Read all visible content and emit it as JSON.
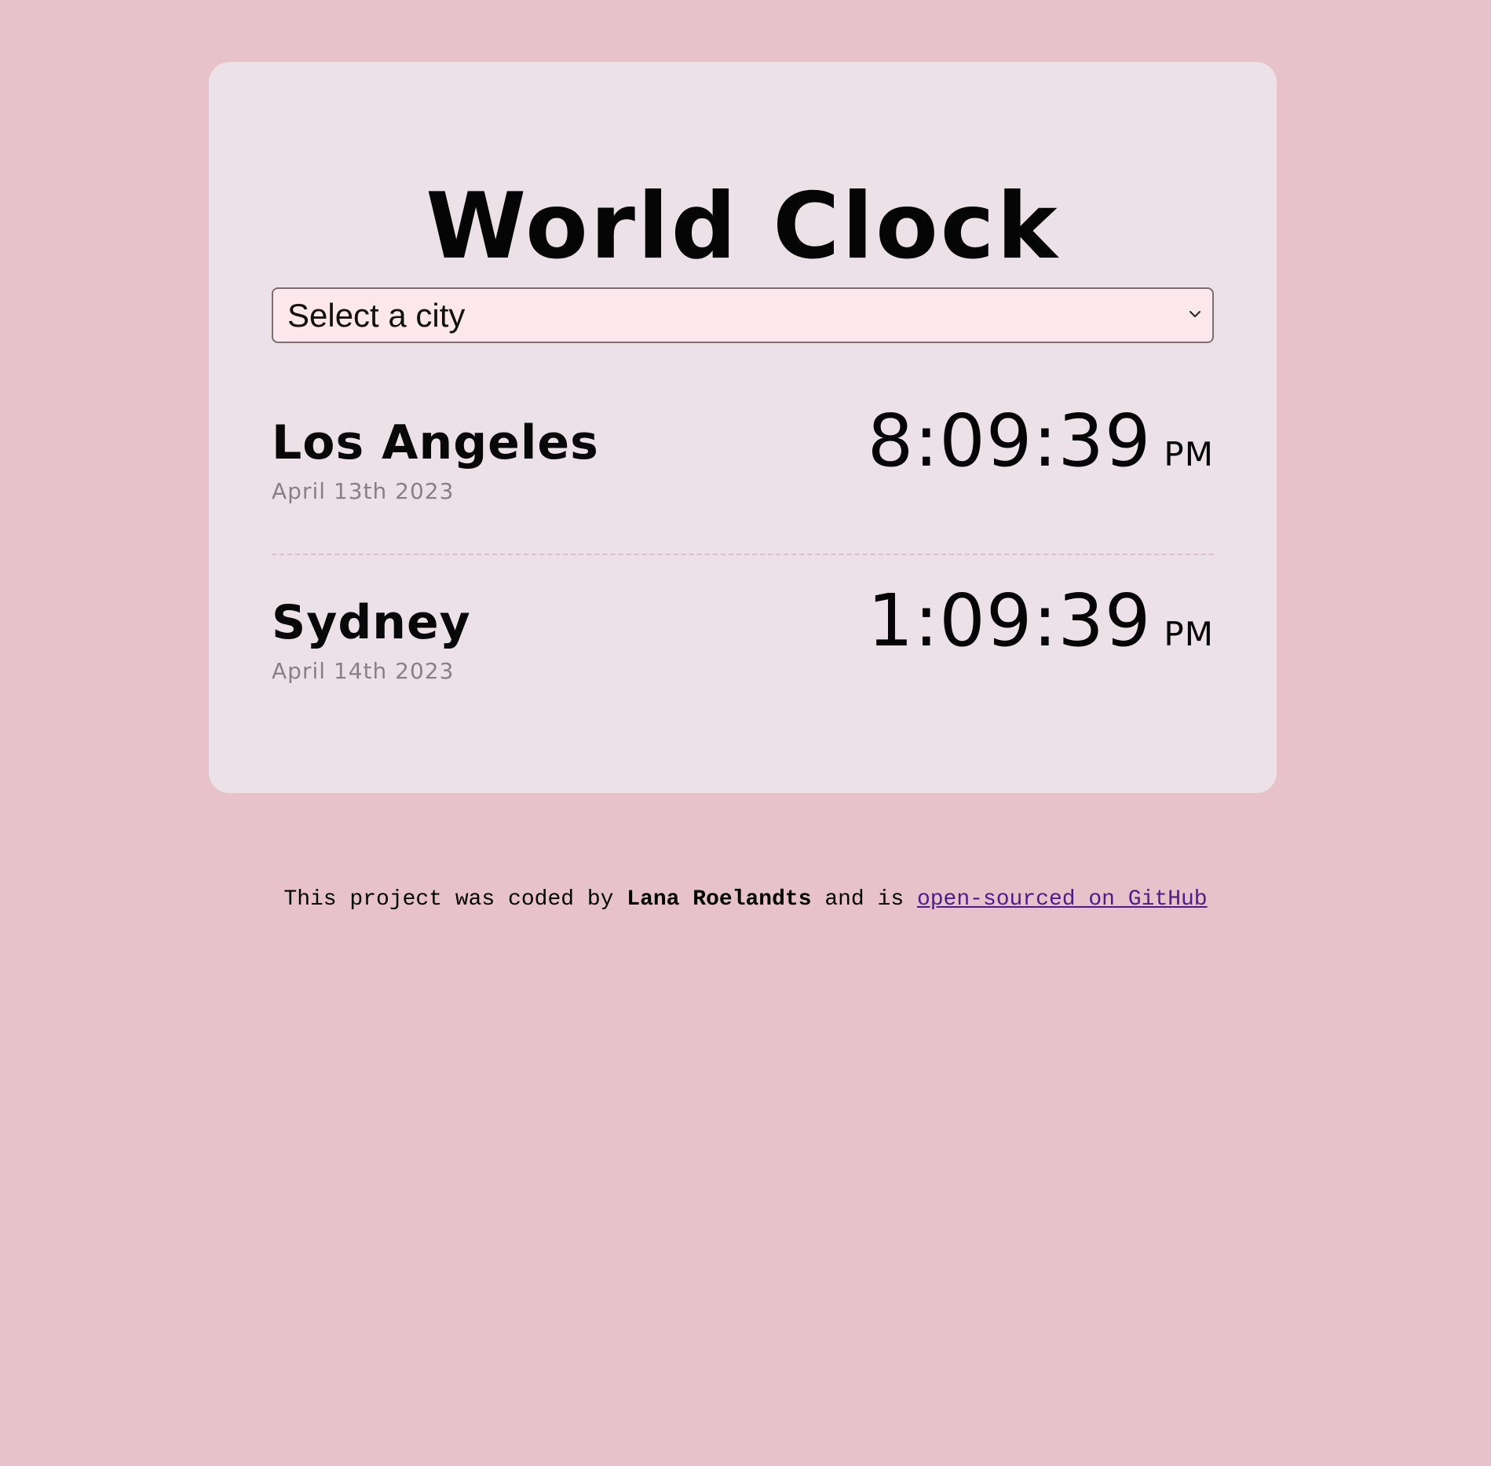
{
  "app": {
    "title": "World Clock"
  },
  "city_select": {
    "selected_label": "Select a city"
  },
  "cities": [
    {
      "name": "Los Angeles",
      "date": "April 13th 2023",
      "time": "8:09:39",
      "ampm": "PM"
    },
    {
      "name": "Sydney",
      "date": "April 14th 2023",
      "time": "1:09:39",
      "ampm": "PM"
    }
  ],
  "footer": {
    "prefix": "This project was coded by ",
    "author": "Lana Roelandts",
    "middle": " and is ",
    "link_text": "open-sourced on GitHub"
  },
  "colors": {
    "page_background": "#e7c2ca",
    "card_background": "#ece1e7",
    "select_background": "#fbe7ec",
    "date_text": "#888084",
    "link": "#4b1d8a"
  },
  "icons": {
    "select_arrow": "chevron-down-icon"
  }
}
